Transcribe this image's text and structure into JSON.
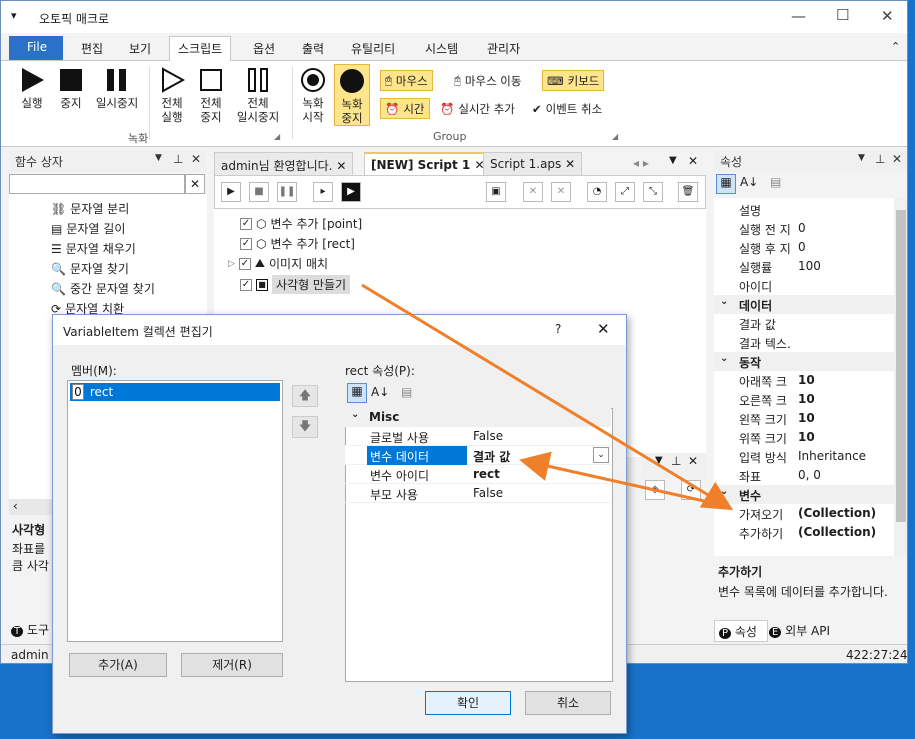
{
  "window": {
    "title": "오토픽 매크로"
  },
  "menu": {
    "file": "File",
    "items": [
      "편집",
      "보기",
      "스크립트",
      "옵션",
      "출력",
      "유틸리티",
      "시스템",
      "관리자"
    ]
  },
  "ribbon": {
    "record_group": "녹화",
    "group_label": "Group",
    "run": "실행",
    "stop": "중지",
    "pause": "일시중지",
    "all_run_1": "전체",
    "all_run_2": "실행",
    "all_stop_1": "전체",
    "all_stop_2": "중지",
    "all_pause_1": "전체",
    "all_pause_2": "일시중지",
    "rec_start_1": "녹화",
    "rec_start_2": "시작",
    "rec_stop_1": "녹화",
    "rec_stop_2": "중지",
    "mouse": "마우스",
    "mouse_move": "마우스 이동",
    "keyboard": "키보드",
    "time": "시간",
    "add_time": "실시간 추가",
    "cancel_event": "이벤트 취소"
  },
  "func_panel": {
    "title": "함수 상자",
    "items": [
      "문자열 분리",
      "문자열 길이",
      "문자열 채우기",
      "문자열 찾기",
      "중간 문자열 찾기",
      "문자열 치환"
    ],
    "desc_title": "사각형",
    "desc_1": "좌표를",
    "desc_2": "큼 사각",
    "bottom_tab": "도구"
  },
  "tabs": [
    "admin님 환영합니다.",
    "[NEW] Script 1",
    "Script 1.aps"
  ],
  "script_tree": [
    {
      "label": "변수 추가 [point]"
    },
    {
      "label": "변수 추가 [rect]"
    },
    {
      "label": "이미지 매치"
    },
    {
      "label": "사각형 만들기"
    }
  ],
  "props": {
    "title": "속성",
    "rows": [
      {
        "k": "설명",
        "v": ""
      },
      {
        "k": "실행 전 지",
        "v": "0"
      },
      {
        "k": "실행 후 지",
        "v": "0"
      },
      {
        "k": "실행률",
        "v": "100"
      },
      {
        "k": "아이디",
        "v": ""
      }
    ],
    "cat_data": "데이터",
    "data_rows": [
      {
        "k": "결과 값",
        "v": ""
      },
      {
        "k": "결과 텍스.",
        "v": ""
      }
    ],
    "cat_action": "동작",
    "action_rows": [
      {
        "k": "아래쪽 크",
        "v": "10"
      },
      {
        "k": "오른쪽 크",
        "v": "10"
      },
      {
        "k": "왼쪽 크기",
        "v": "10"
      },
      {
        "k": "위쪽 크기",
        "v": "10"
      },
      {
        "k": "입력 방식",
        "v": "Inheritance"
      },
      {
        "k": "좌표",
        "v": "0, 0"
      }
    ],
    "cat_var": "변수",
    "var_rows": [
      {
        "k": "가져오기",
        "v": "(Collection)"
      },
      {
        "k": "추가하기",
        "v": "(Collection)"
      }
    ],
    "desc_title": "추가하기",
    "desc_text": "변수 목록에 데이터를 추가합니다.",
    "tab_props": "속성",
    "tab_api": "외부 API"
  },
  "status": {
    "user": "admin",
    "time": "422:27:24"
  },
  "dialog": {
    "title": "VariableItem 컬렉션 편집기",
    "help": "?",
    "members_label": "멤버(M):",
    "member_index": "0",
    "member_name": "rect",
    "props_label": "rect 속성(P):",
    "cat": "Misc",
    "rows": [
      {
        "k": "글로벌 사용",
        "v": "False"
      },
      {
        "k": "변수 데이터",
        "v": "결과 값"
      },
      {
        "k": "변수 아이디",
        "v": "rect"
      },
      {
        "k": "부모 사용",
        "v": "False"
      }
    ],
    "add": "추가(A)",
    "remove": "제거(R)",
    "ok": "확인",
    "cancel": "취소"
  },
  "colors": {
    "accent": "#2b71c7",
    "annotation": "#f07f2c",
    "highlight": "#fde58c"
  }
}
